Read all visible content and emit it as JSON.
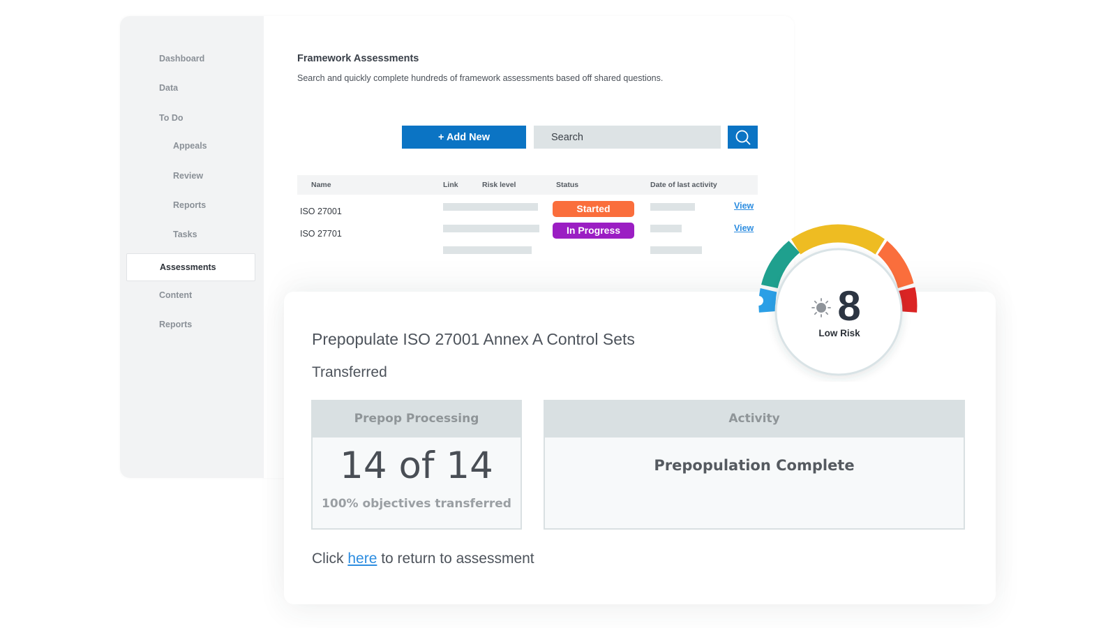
{
  "sidebar": {
    "items": [
      {
        "label": "Dashboard"
      },
      {
        "label": "Data"
      },
      {
        "label": "To Do"
      },
      {
        "label": "Appeals"
      },
      {
        "label": "Review"
      },
      {
        "label": "Reports"
      },
      {
        "label": "Tasks"
      },
      {
        "label": "Assessments",
        "active": true
      },
      {
        "label": "Content"
      },
      {
        "label": "Reports"
      }
    ]
  },
  "assessments": {
    "title": "Framework Assessments",
    "subtitle": "Search and quickly complete hundreds of framework assessments based off shared questions.",
    "add_label": "+ Add New",
    "search_placeholder": "Search",
    "search_icon": "search-icon",
    "columns": [
      "Name",
      "Link",
      "Risk level",
      "Status",
      "Date of last activity"
    ],
    "rows": [
      {
        "name": "ISO 27001",
        "status": "Started",
        "status_color": "#fa6e3c",
        "action": "View"
      },
      {
        "name": "ISO 27701",
        "status": "In Progress",
        "status_color": "#9b1ec3",
        "action": "View"
      }
    ]
  },
  "prepop": {
    "title": "Prepopulate ISO 27001 Annex A Control Sets",
    "status": "Transferred",
    "processing_label": "Prepop Processing",
    "count_text": "14 of 14",
    "caption": "100% objectives transferred",
    "activity_label": "Activity",
    "activity_text": "Prepopulation Complete",
    "return_prefix": "Click ",
    "return_link": "here",
    "return_suffix": " to return to assessment"
  },
  "risk": {
    "score": "8",
    "label": "Low Risk",
    "icon": "sun-icon",
    "segment_colors": [
      "#2b9fe6",
      "#1fa08e",
      "#eebc22",
      "#fa6e3c",
      "#db2424"
    ]
  },
  "colors": {
    "primary": "#0b74c4",
    "link": "#2d8de0"
  }
}
